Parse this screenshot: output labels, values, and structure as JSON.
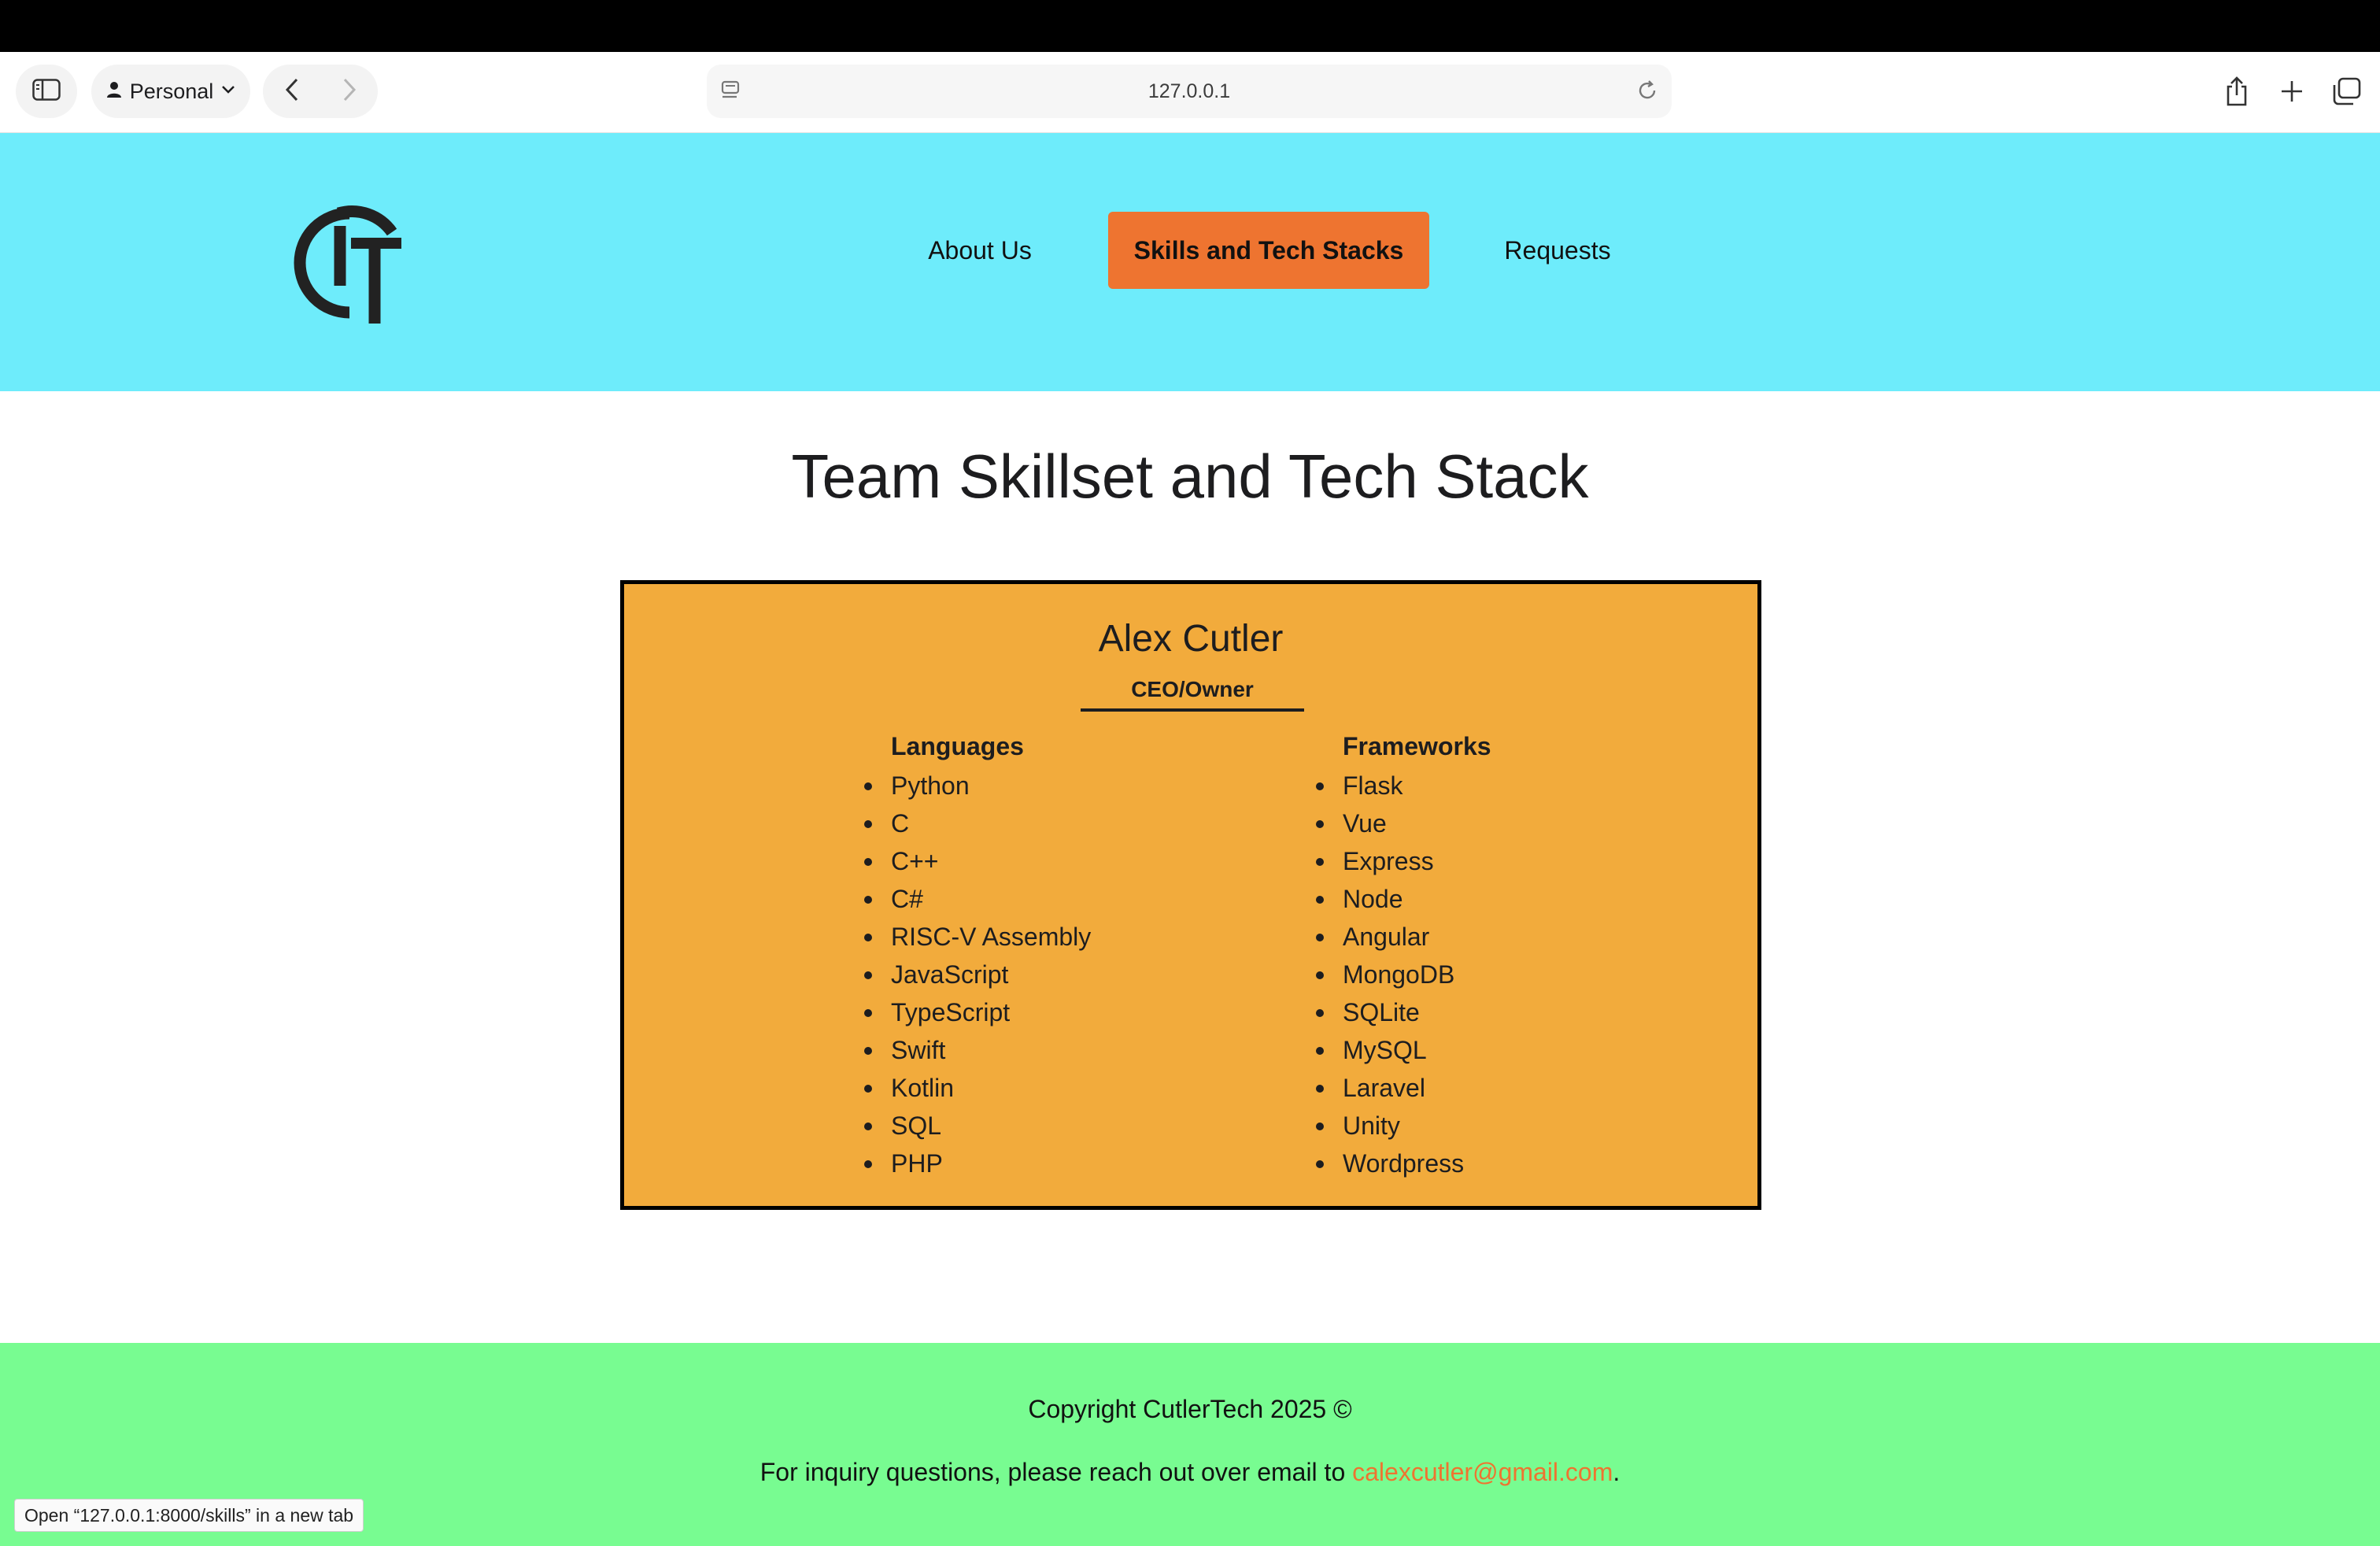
{
  "browser": {
    "profile_label": "Personal",
    "url": "127.0.0.1",
    "icons": [
      "sidebar-icon",
      "person-icon",
      "chevron-down-icon",
      "back-arrow-icon",
      "forward-arrow-icon",
      "site-settings-icon",
      "reload-icon",
      "share-icon",
      "new-tab-plus-icon",
      "tab-overview-icon"
    ],
    "status_tooltip": "Open “127.0.0.1:8000/skills” in a new tab"
  },
  "header": {
    "logo_text": "CT",
    "nav": [
      {
        "label": "About Us",
        "active": false
      },
      {
        "label": "Skills and Tech Stacks",
        "active": true
      },
      {
        "label": "Requests",
        "active": false
      }
    ],
    "colors": {
      "background": "#6eecfb",
      "active_nav": "#ee7430"
    }
  },
  "main": {
    "title": "Team Skillset and Tech Stack",
    "member": {
      "name": "Alex Cutler",
      "role": "CEO/Owner",
      "languages_title": "Languages",
      "languages": [
        "Python",
        "C",
        "C++",
        "C#",
        "RISC-V Assembly",
        "JavaScript",
        "TypeScript",
        "Swift",
        "Kotlin",
        "SQL",
        "PHP"
      ],
      "frameworks_title": "Frameworks",
      "frameworks": [
        "Flask",
        "Vue",
        "Express",
        "Node",
        "Angular",
        "MongoDB",
        "SQLite",
        "MySQL",
        "Laravel",
        "Unity",
        "Wordpress"
      ],
      "card_color": "#f2ab3c"
    }
  },
  "footer": {
    "copyright": "Copyright CutlerTech 2025 ©",
    "inquiry_text": "For inquiry questions, please reach out over email to ",
    "email": "calexcutler@gmail.com",
    "inquiry_end": ".",
    "background": "#78fc91"
  }
}
